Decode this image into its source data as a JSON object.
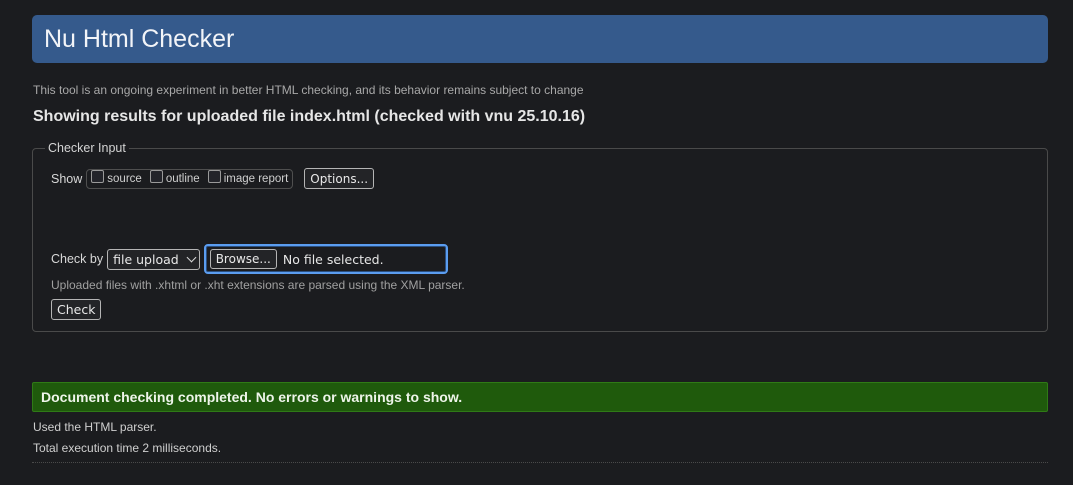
{
  "header": {
    "title": "Nu Html Checker"
  },
  "notice": "This tool is an ongoing experiment in better HTML checking, and its behavior remains subject to change",
  "results_heading": "Showing results for uploaded file index.html (checked with vnu 25.10.16)",
  "checker_input": {
    "legend": "Checker Input",
    "show_label": "Show",
    "show_options": [
      {
        "label": "source",
        "checked": false
      },
      {
        "label": "outline",
        "checked": false
      },
      {
        "label": "image report",
        "checked": false
      }
    ],
    "options_button": "Options...",
    "check_by_label": "Check by",
    "check_by_value": "file upload",
    "browse_button": "Browse...",
    "file_status": "No file selected.",
    "xml_note": "Uploaded files with .xhtml or .xht extensions are parsed using the XML parser.",
    "check_button": "Check"
  },
  "result": {
    "message": "Document checking completed. No errors or warnings to show.",
    "parser_note": "Used the HTML parser.",
    "execution_time": "Total execution time 2 milliseconds."
  },
  "colors": {
    "header_bg": "#355a8c",
    "success_bg": "#1f5a0c",
    "focus_ring": "#5b9df0",
    "page_bg": "#1b1c1f"
  }
}
